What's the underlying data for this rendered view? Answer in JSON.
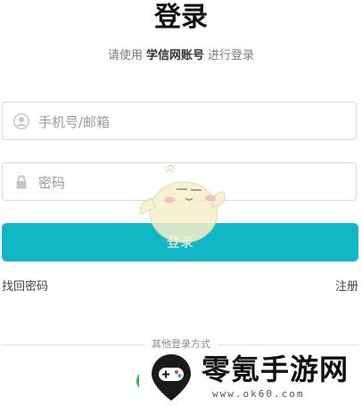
{
  "page": {
    "title": "登录",
    "subtitle_prefix": "请使用",
    "subtitle_account": "学信网账号",
    "subtitle_suffix": "进行登录"
  },
  "form": {
    "username": {
      "value": "",
      "placeholder": "手机号/邮箱",
      "icon": "user-icon"
    },
    "password": {
      "value": "",
      "placeholder": "密码",
      "icon": "lock-icon"
    },
    "login_label": "登录"
  },
  "links": {
    "forgot_password": "找回密码",
    "register": "注册"
  },
  "other_login": {
    "label": "其他登录方式",
    "methods": [
      {
        "icon": "wechat-icon",
        "color": "#35b34a"
      }
    ]
  },
  "watermark": {
    "title": "零氪手游网",
    "url": "www.ok60.com"
  },
  "colors": {
    "accent": "#12b7c5",
    "border": "#d9d9d9",
    "placeholder": "#9a9a9a"
  }
}
